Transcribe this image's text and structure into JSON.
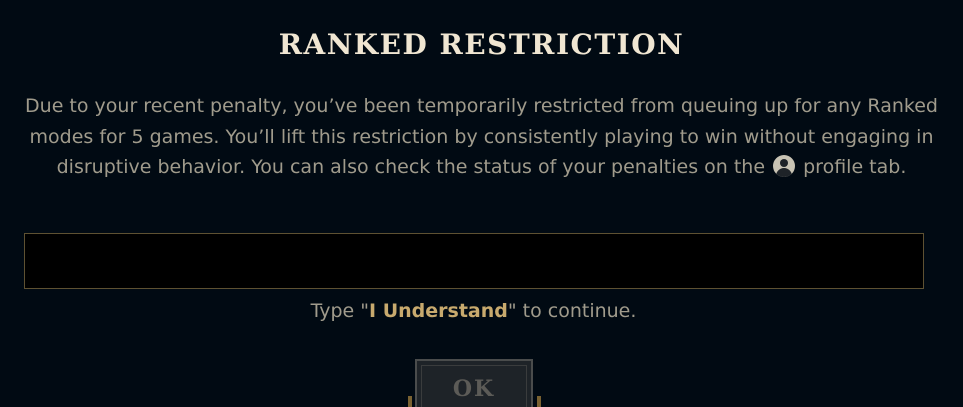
{
  "dialog": {
    "title": "RANKED RESTRICTION",
    "body_before_icon": "Due to your recent penalty, you’ve been temporarily restricted from queuing up for any Ranked modes for 5 games. You’ll lift this restriction by consistently playing to win without engaging in disruptive behavior. You can also check the status of your penalties on the",
    "body_after_icon": "profile tab.",
    "profile_icon": "profile-avatar-icon",
    "input_value": "",
    "hint_prefix": "Type \"",
    "hint_phrase": "I Understand",
    "hint_suffix": "\" to continue.",
    "ok_label": "OK"
  },
  "colors": {
    "background": "#010a13",
    "title": "#f0e6d2",
    "body_text": "#a09b8c",
    "gold_accent": "#c8aa6e",
    "input_border": "#5e5132",
    "button_disabled_text": "#5c5b57"
  }
}
